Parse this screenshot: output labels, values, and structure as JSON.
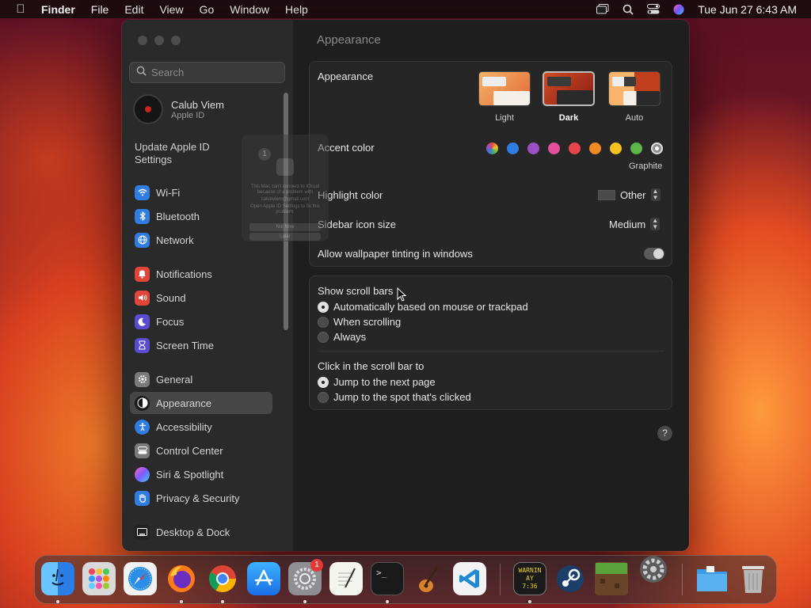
{
  "menubar": {
    "app_name": "Finder",
    "menus": [
      "File",
      "Edit",
      "View",
      "Go",
      "Window",
      "Help"
    ],
    "datetime": "Tue Jun 27  6:43 AM"
  },
  "sidebar": {
    "search_placeholder": "Search",
    "account": {
      "name": "Calub Viem",
      "subtitle": "Apple ID"
    },
    "update": {
      "label": "Update Apple ID Settings",
      "badge": "1"
    },
    "items": [
      {
        "label": "Wi-Fi",
        "icon": "wifi-icon",
        "color": "#2f7de0"
      },
      {
        "label": "Bluetooth",
        "icon": "bluetooth-icon",
        "color": "#2f7de0"
      },
      {
        "label": "Network",
        "icon": "globe-icon",
        "color": "#2f7de0"
      },
      {
        "label": "Notifications",
        "icon": "bell-icon",
        "color": "#e0453a"
      },
      {
        "label": "Sound",
        "icon": "speaker-icon",
        "color": "#e0453a"
      },
      {
        "label": "Focus",
        "icon": "moon-icon",
        "color": "#5b4ccf"
      },
      {
        "label": "Screen Time",
        "icon": "hourglass-icon",
        "color": "#5b4ccf"
      },
      {
        "label": "General",
        "icon": "gear-icon",
        "color": "#7a7a7a"
      },
      {
        "label": "Appearance",
        "icon": "appearance-icon",
        "color": "#1a1a1a"
      },
      {
        "label": "Accessibility",
        "icon": "accessibility-icon",
        "color": "#2f7de0"
      },
      {
        "label": "Control Center",
        "icon": "control-center-icon",
        "color": "#7a7a7a"
      },
      {
        "label": "Siri & Spotlight",
        "icon": "siri-icon",
        "color": "#b03bd6"
      },
      {
        "label": "Privacy & Security",
        "icon": "hand-icon",
        "color": "#2f7de0"
      },
      {
        "label": "Desktop & Dock",
        "icon": "desktop-icon",
        "color": "#222222"
      }
    ]
  },
  "main": {
    "title": "Appearance",
    "appearance": {
      "label": "Appearance",
      "options": [
        "Light",
        "Dark",
        "Auto"
      ],
      "selected": "Dark"
    },
    "accent": {
      "label": "Accent color",
      "selected_name": "Graphite",
      "colors": [
        "multicolor",
        "#2f7de0",
        "#9a4fc4",
        "#e34f9b",
        "#e6464b",
        "#f08a24",
        "#f5c022",
        "#5cb748",
        "#8e8e8e"
      ]
    },
    "highlight": {
      "label": "Highlight color",
      "value": "Other"
    },
    "sidebar_icon_size": {
      "label": "Sidebar icon size",
      "value": "Medium"
    },
    "wallpaper_tinting": {
      "label": "Allow wallpaper tinting in windows",
      "on": true
    },
    "scroll_bars": {
      "label": "Show scroll bars",
      "options": [
        "Automatically based on mouse or trackpad",
        "When scrolling",
        "Always"
      ],
      "selected": 0
    },
    "click_scroll": {
      "label": "Click in the scroll bar to",
      "options": [
        "Jump to the next page",
        "Jump to the spot that's clicked"
      ],
      "selected": 0
    },
    "help": "?"
  },
  "ghost_notification": {
    "line1": "This Mac can't connect to iCloud because of a problem with",
    "line2": "calubviem@gmail.com",
    "line3": "Open Apple ID Settings to fix this problem.",
    "btn1": "Not Now",
    "btn2": "Later"
  },
  "dock": {
    "apps": [
      "Finder",
      "Launchpad",
      "Safari",
      "Firefox",
      "Chrome",
      "App Store",
      "System Settings",
      "TextEdit",
      "Terminal",
      "GarageBand",
      "Visual Studio Code",
      "Console",
      "Steam",
      "Minecraft",
      "Settings Gear",
      "Folder",
      "Trash"
    ],
    "badge": "1",
    "console_text": "WARNIN AY 7:36"
  }
}
